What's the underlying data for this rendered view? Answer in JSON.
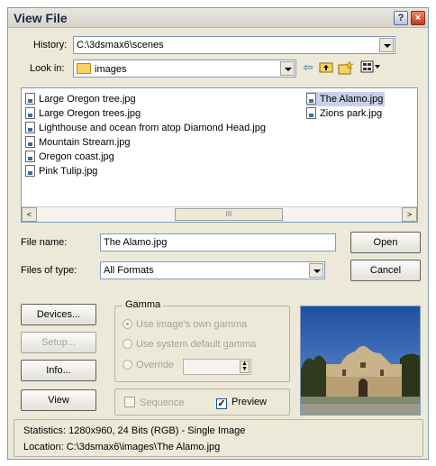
{
  "window": {
    "title": "View File"
  },
  "title_buttons": {
    "help": "?",
    "close": "×"
  },
  "history": {
    "label": "History:",
    "value": "C:\\3dsmax6\\scenes"
  },
  "look_in": {
    "label": "Look in:",
    "value": "images"
  },
  "toolbar_icons": [
    "back-arrow-icon",
    "up-folder-icon",
    "new-folder-icon",
    "view-menu-icon"
  ],
  "file_list": {
    "column1": [
      "Large Oregon tree.jpg",
      "Large Oregon trees.jpg",
      "Lighthouse and ocean from atop Diamond Head.jpg",
      "Mountain Stream.jpg",
      "Oregon coast.jpg",
      "Pink Tulip.jpg"
    ],
    "column2": [
      "The Alamo.jpg",
      "Zions park.jpg"
    ],
    "selected": "The Alamo.jpg",
    "scroll_left": "<",
    "scroll_right": ">",
    "thumb_grip": "III"
  },
  "file_name": {
    "label": "File name:",
    "value": "The Alamo.jpg"
  },
  "file_type": {
    "label": "Files of type:",
    "value": "All Formats"
  },
  "buttons": {
    "open": "Open",
    "cancel": "Cancel",
    "devices": "Devices...",
    "setup": "Setup...",
    "info": "Info...",
    "view": "View"
  },
  "gamma": {
    "title": "Gamma",
    "option1": "Use image's own gamma",
    "option2": "Use system default gamma",
    "option3": "Override",
    "override_value": ""
  },
  "sequence": {
    "label": "Sequence",
    "checked": false
  },
  "preview_toggle": {
    "label": "Preview",
    "checked": true
  },
  "statistics": {
    "stats_line": "Statistics:  1280x960, 24 Bits (RGB) - Single Image",
    "location_line": "Location:  C:\\3dsmax6\\images\\The Alamo.jpg"
  },
  "colors": {
    "dialog_bg": "#ece9d8",
    "selection": "#c7d2e8",
    "border": "#7f9db9"
  }
}
